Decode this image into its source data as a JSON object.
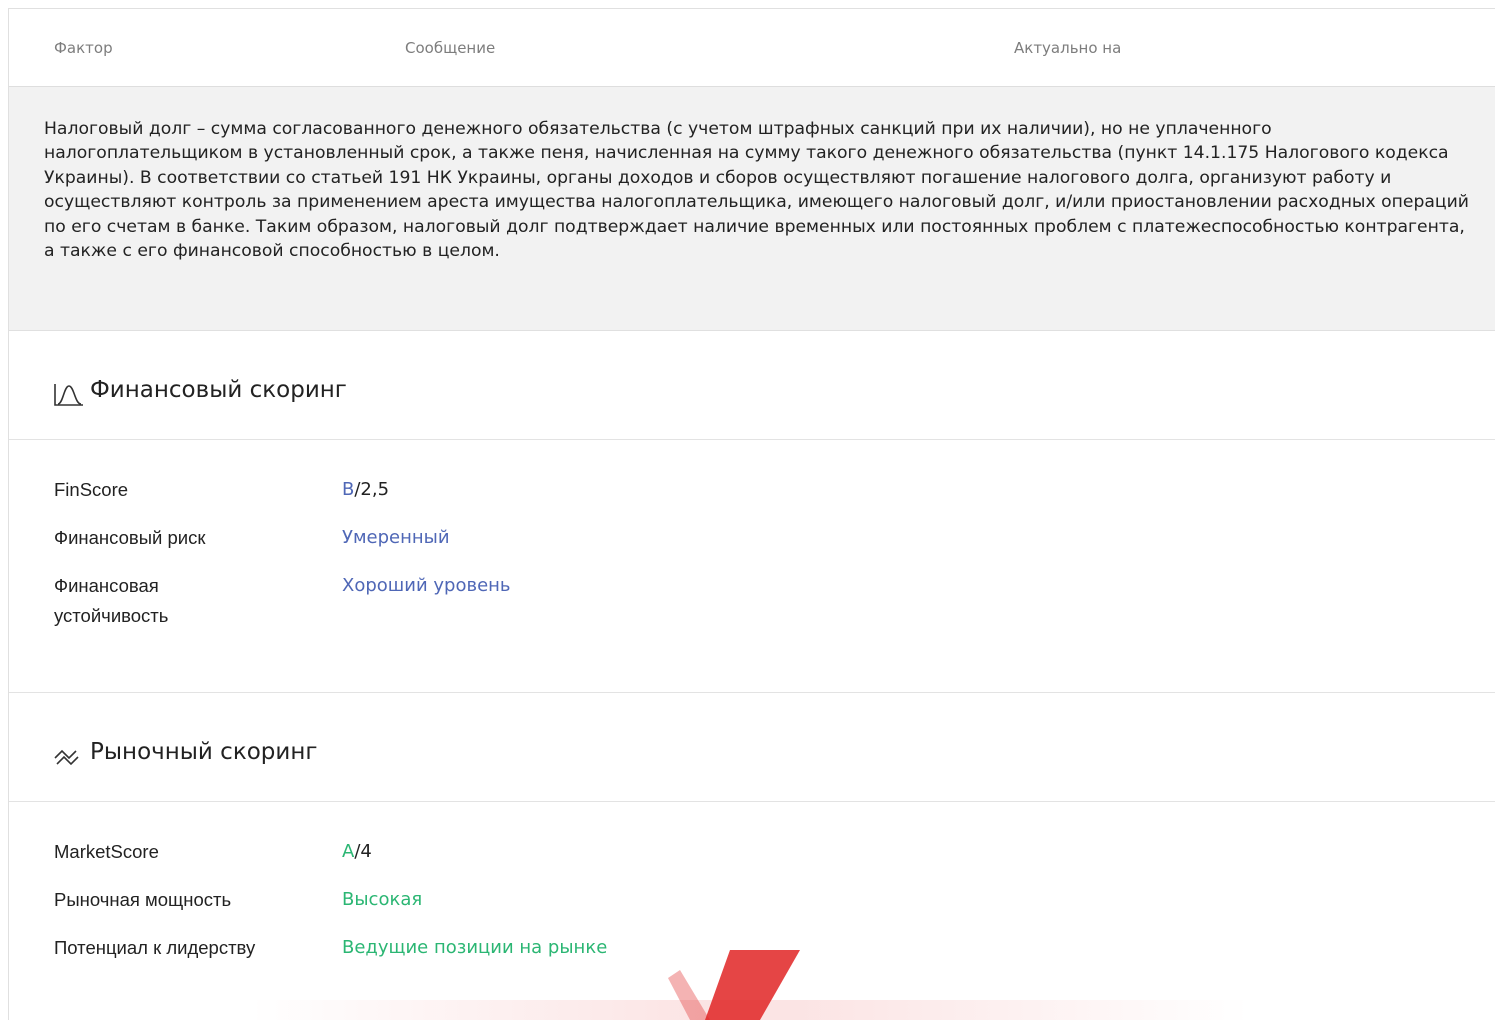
{
  "table_header": {
    "col_factor": "Фактор",
    "col_message": "Сообщение",
    "col_actual": "Актуально на"
  },
  "info_text": "Налоговый долг – сумма согласованного денежного обязательства (с учетом штрафных санкций при их наличии), но не уплаченного налогоплательщиком в установленный срок, а также пеня, начисленная на сумму такого денежного обязательства (пункт 14.1.175 Налогового кодекса Украины). В соответствии со статьей 191 НК Украины, органы доходов и сборов осуществляют погашение налогового долга, организуют работу и осуществляют контроль за применением ареста имущества налогоплательщика, имеющего налоговый долг, и/или приостановлении расходных операций по его счетам в банке. Таким образом, налоговый долг подтверждает наличие временных или постоянных проблем с платежеспособностью контрагента, а также с его финансовой способностью в целом.",
  "financial": {
    "title": "Финансовый скоринг",
    "icon": "bell-curve-icon",
    "rows": [
      {
        "key": "FinScore",
        "grade": "B",
        "score": "/2,5"
      },
      {
        "key": "Финансовый риск",
        "value": "Умеренный"
      },
      {
        "key": "Финансовая устойчивость",
        "value": "Хороший уровень"
      }
    ]
  },
  "market": {
    "title": "Рыночный скоринг",
    "icon": "trend-lines-icon",
    "rows": [
      {
        "key": "MarketScore",
        "grade": "A",
        "score": "/4"
      },
      {
        "key": "Рыночная мощность",
        "value": "Высокая"
      },
      {
        "key": "Потенциал к лидерству",
        "value": "Ведущие позиции на рынке"
      }
    ]
  },
  "colors": {
    "financial_value": "#4f67b6",
    "market_value": "#2bb673",
    "info_background": "#f2f2f2",
    "watermark": "#e02424"
  }
}
